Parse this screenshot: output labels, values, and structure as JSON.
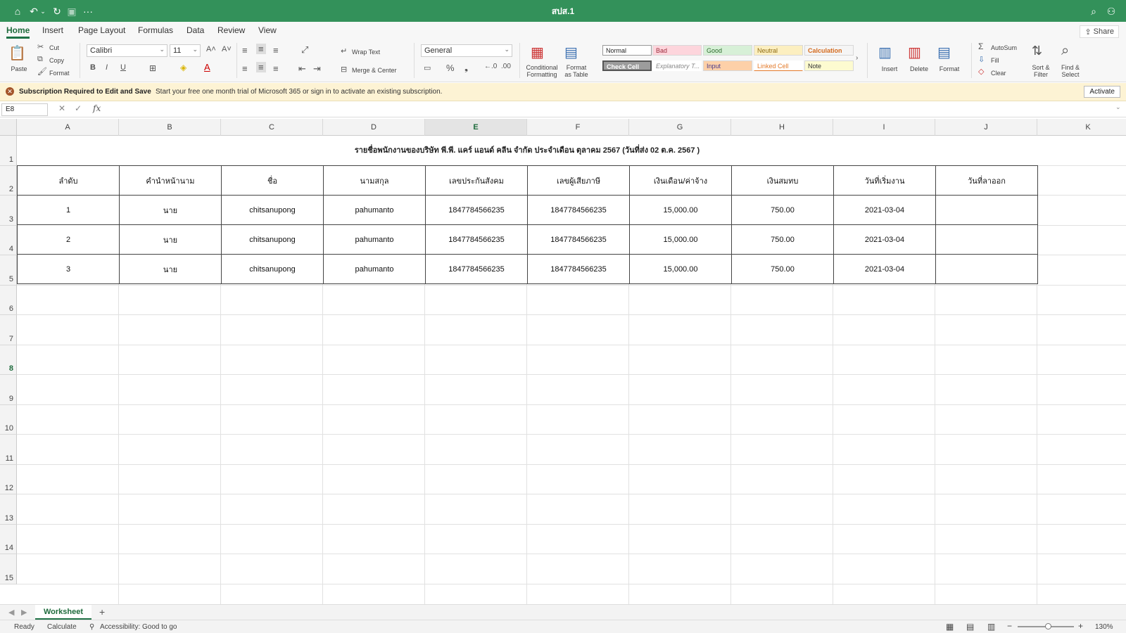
{
  "doc_title": "สปส.1",
  "ribbon_tabs": [
    "Home",
    "Insert",
    "Page Layout",
    "Formulas",
    "Data",
    "Review",
    "View"
  ],
  "share_label": "Share",
  "clipboard": {
    "paste": "Paste",
    "cut": "Cut",
    "copy": "Copy",
    "format": "Format"
  },
  "font": {
    "name": "Calibri",
    "size": "11"
  },
  "alignment": {
    "wrap_text": "Wrap Text",
    "merge_center": "Merge & Center"
  },
  "number_format": "General",
  "styles": {
    "conditional": "Conditional Formatting",
    "format_table": "Format as Table",
    "cells": [
      "Normal",
      "Bad",
      "Good",
      "Neutral",
      "Calculation",
      "Check Cell",
      "Explanatory T...",
      "Input",
      "Linked Cell",
      "Note"
    ]
  },
  "cells_group": {
    "insert": "Insert",
    "delete": "Delete",
    "format": "Format"
  },
  "editing": {
    "autosum": "AutoSum",
    "fill": "Fill",
    "clear": "Clear",
    "sort_filter": "Sort & Filter",
    "find_select": "Find & Select"
  },
  "notice": {
    "title": "Subscription Required to Edit and Save",
    "message": "Start your free one month trial of Microsoft 365 or sign in to activate an existing subscription.",
    "activate": "Activate"
  },
  "name_box": "E8",
  "columns": [
    "A",
    "B",
    "C",
    "D",
    "E",
    "F",
    "G",
    "H",
    "I",
    "J",
    "K"
  ],
  "selected_column": "E",
  "rows": [
    "1",
    "2",
    "3",
    "4",
    "5",
    "6",
    "7",
    "8",
    "9",
    "10",
    "11",
    "12",
    "13",
    "14",
    "15"
  ],
  "selected_row": "8",
  "sheet_title": "รายชื่อพนักงานของบริษัท พี.พี. แคร์ แอนด์ คลีน จำกัด ประจำเดือน ตุลาคม 2567 (วันที่ส่ง 02 ต.ค. 2567 )",
  "table": {
    "headers": [
      "ลำดับ",
      "คำนำหน้านาม",
      "ชื่อ",
      "นามสกุล",
      "เลขประกันสังคม",
      "เลขผู้เสียภาษี",
      "เงินเดือน/ค่าจ้าง",
      "เงินสมทบ",
      "วันที่เริ่มงาน",
      "วันที่ลาออก"
    ],
    "rows": [
      [
        "1",
        "นาย",
        "chitsanupong",
        "pahumanto",
        "1847784566235",
        "1847784566235",
        "15,000.00",
        "750.00",
        "2021-03-04",
        ""
      ],
      [
        "2",
        "นาย",
        "chitsanupong",
        "pahumanto",
        "1847784566235",
        "1847784566235",
        "15,000.00",
        "750.00",
        "2021-03-04",
        ""
      ],
      [
        "3",
        "นาย",
        "chitsanupong",
        "pahumanto",
        "1847784566235",
        "1847784566235",
        "15,000.00",
        "750.00",
        "2021-03-04",
        ""
      ]
    ]
  },
  "sheet_tab": "Worksheet",
  "status": {
    "ready": "Ready",
    "calculate": "Calculate",
    "accessibility": "Accessibility: Good to go",
    "zoom": "130%"
  },
  "colors": {
    "title_bar": "#33915a",
    "accent": "#1e7145"
  }
}
